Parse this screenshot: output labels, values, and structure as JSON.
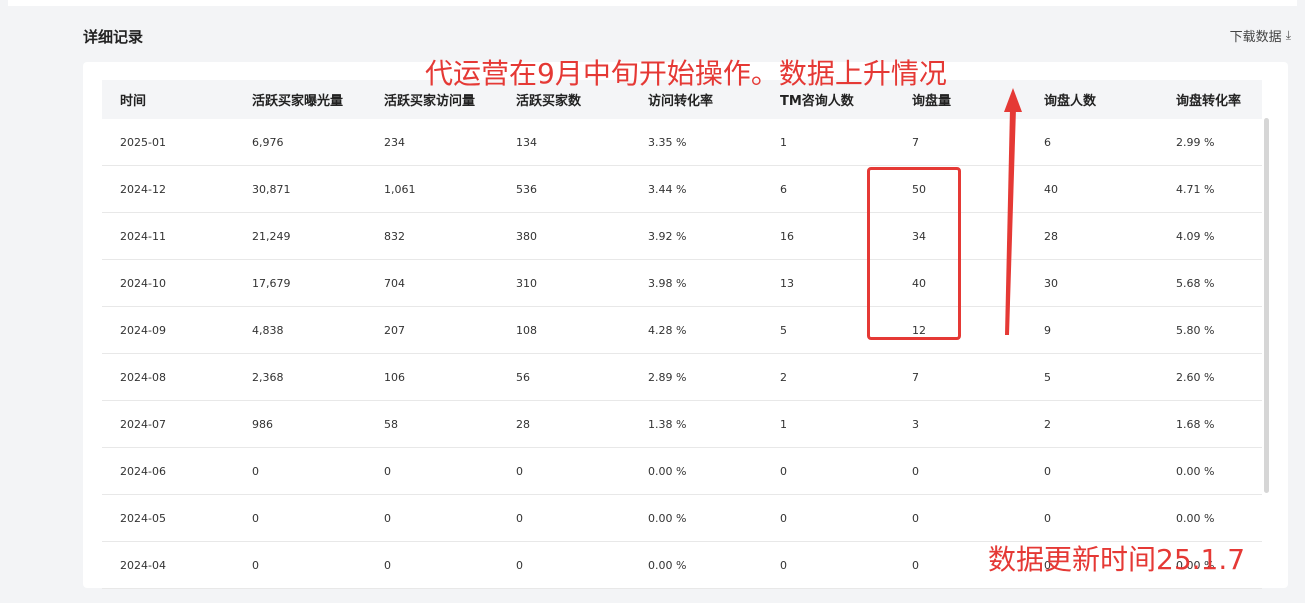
{
  "section": {
    "title": "详细记录",
    "download_label": "下载数据"
  },
  "table": {
    "headers": [
      "时间",
      "活跃买家曝光量",
      "活跃买家访问量",
      "活跃买家数",
      "访问转化率",
      "TM咨询人数",
      "询盘量",
      "询盘人数",
      "询盘转化率"
    ],
    "rows": [
      [
        "2025-01",
        "6,976",
        "234",
        "134",
        "3.35 %",
        "1",
        "7",
        "6",
        "2.99 %"
      ],
      [
        "2024-12",
        "30,871",
        "1,061",
        "536",
        "3.44 %",
        "6",
        "50",
        "40",
        "4.71 %"
      ],
      [
        "2024-11",
        "21,249",
        "832",
        "380",
        "3.92 %",
        "16",
        "34",
        "28",
        "4.09 %"
      ],
      [
        "2024-10",
        "17,679",
        "704",
        "310",
        "3.98 %",
        "13",
        "40",
        "30",
        "5.68 %"
      ],
      [
        "2024-09",
        "4,838",
        "207",
        "108",
        "4.28 %",
        "5",
        "12",
        "9",
        "5.80 %"
      ],
      [
        "2024-08",
        "2,368",
        "106",
        "56",
        "2.89 %",
        "2",
        "7",
        "5",
        "2.60 %"
      ],
      [
        "2024-07",
        "986",
        "58",
        "28",
        "1.38 %",
        "1",
        "3",
        "2",
        "1.68 %"
      ],
      [
        "2024-06",
        "0",
        "0",
        "0",
        "0.00 %",
        "0",
        "0",
        "0",
        "0.00 %"
      ],
      [
        "2024-05",
        "0",
        "0",
        "0",
        "0.00 %",
        "0",
        "0",
        "0",
        "0.00 %"
      ],
      [
        "2024-04",
        "0",
        "0",
        "0",
        "0.00 %",
        "0",
        "0",
        "0",
        "0.00 %"
      ]
    ]
  },
  "annotations": {
    "title": "代运营在9月中旬开始操作。数据上升情况",
    "update_time": "数据更新时间25.1.7",
    "color": "#e53935"
  },
  "icons": {
    "download": "download-icon"
  }
}
